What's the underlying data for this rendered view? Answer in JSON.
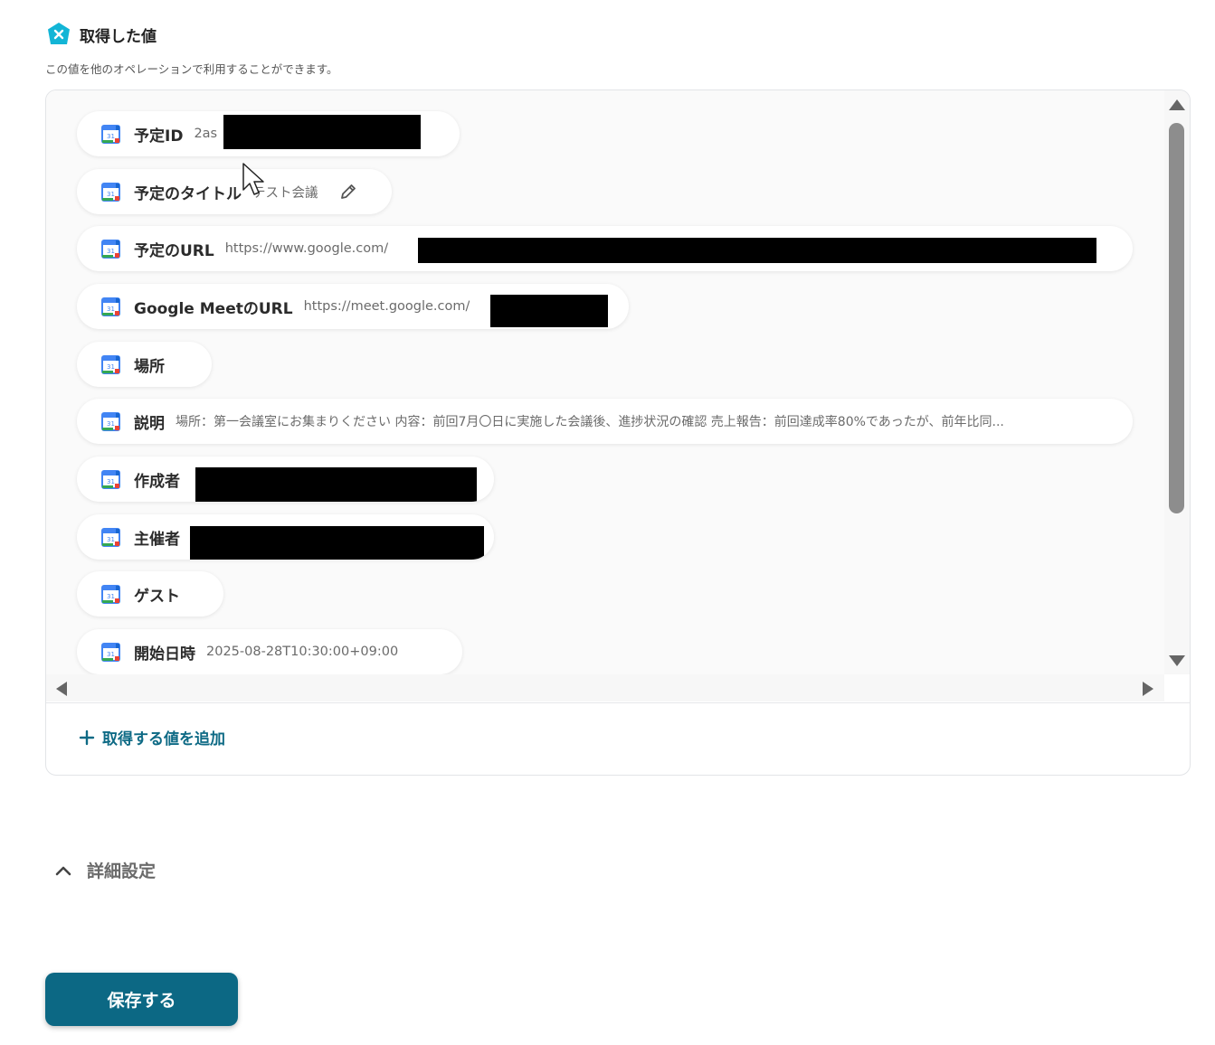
{
  "section": {
    "title": "取得した値",
    "subtitle": "この値を他のオペレーションで利用することができます。",
    "badge_icon": "yoom-badge-icon",
    "accent_color": "#12b5d6"
  },
  "outputs": [
    {
      "label": "予定ID",
      "value": "2as",
      "redacted": true
    },
    {
      "label": "予定のタイトル",
      "value": "テスト会議",
      "editable": true
    },
    {
      "label": "予定のURL",
      "value": "https://www.google.com/",
      "redacted": true
    },
    {
      "label": "Google MeetのURL",
      "value": "https://meet.google.com/",
      "redacted": true
    },
    {
      "label": "場所",
      "value": ""
    },
    {
      "label": "説明",
      "value": "場所：第一会議室にお集まりください 内容：前回7月〇日に実施した会議後、進捗状況の確認 売上報告：前回達成率80%であったが、前年比同..."
    },
    {
      "label": "作成者",
      "value": "",
      "redacted": true
    },
    {
      "label": "主催者",
      "value": "",
      "redacted": true
    },
    {
      "label": "ゲスト",
      "value": ""
    },
    {
      "label": "開始日時",
      "value": "2025-08-28T10:30:00+09:00"
    }
  ],
  "add_value_label": "取得する値を追加",
  "details_label": "詳細設定",
  "save_label": "保存する",
  "colors": {
    "primary": "#0c6884",
    "link": "#0e6a85"
  }
}
